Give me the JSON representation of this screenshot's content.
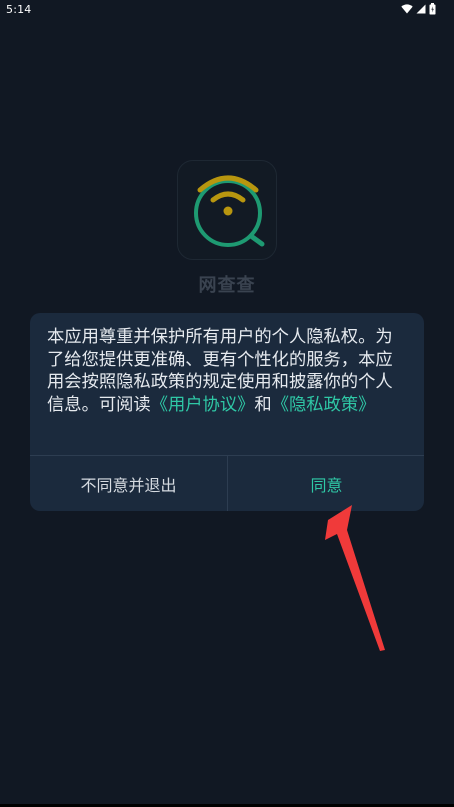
{
  "status_bar": {
    "time": "5:14",
    "icons": [
      "wifi-icon",
      "cellular-signal-icon",
      "battery-icon"
    ]
  },
  "app": {
    "name": "网查查",
    "logo_icon": "wifi-search-icon",
    "logo_colors": {
      "arc": "#b8960f",
      "ring": "#1e9a72"
    }
  },
  "dialog": {
    "message_part1": "本应用尊重并保护所有用户的个人隐私权。为了给您提供更准确、更有个性化的服务，本应用会按照隐私政策的规定使用和披露你的个人信息。可阅读",
    "user_agreement_link": "《用户协议》",
    "message_and": "和",
    "privacy_policy_link": "《隐私政策》",
    "disagree_label": "不同意并退出",
    "agree_label": "同意",
    "link_color": "#2fc8a6"
  },
  "annotation": {
    "arrow_icon": "red-arrow-icon",
    "arrow_color": "#f03a3a"
  }
}
